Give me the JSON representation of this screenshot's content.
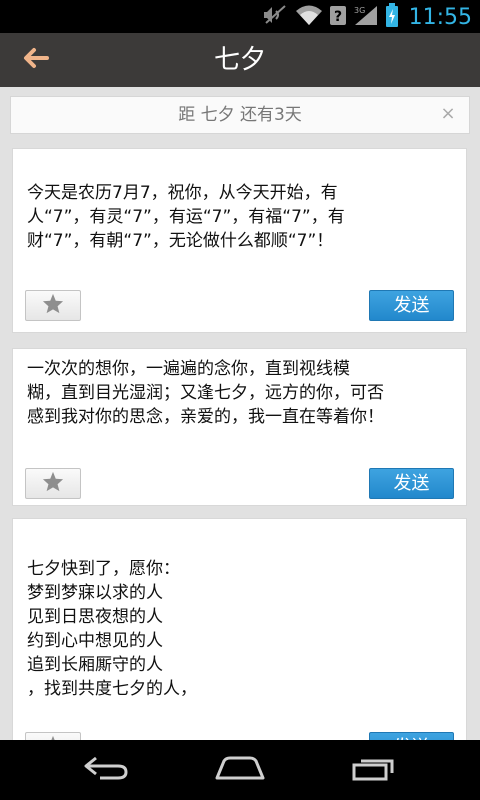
{
  "status_bar": {
    "time": "11:55",
    "icons": [
      "mute-icon",
      "wifi-icon",
      "signal-unknown-icon",
      "3g-signal-icon",
      "battery-charging-icon"
    ],
    "network_label": "3G",
    "accent_color": "#33b5e5"
  },
  "header": {
    "title": "七夕",
    "back_icon": "arrow-left-icon",
    "back_color": "#f0b48a"
  },
  "countdown": {
    "text": "距 七夕 还有3天",
    "close_label": "×"
  },
  "messages": [
    {
      "text": "今天是农历7月7，祝你，从今天开始，有\n人“7”，有灵“7”，有运“7”，有福“7”，有\n财“7”，有朝“7”，无论做什么都顺“7”！",
      "send_label": "发送",
      "favorite_icon": "star-icon"
    },
    {
      "text": "一次次的想你，一遍遍的念你，直到视线模\n糊，直到目光湿润；又逢七夕，远方的你，可否\n感到我对你的思念，亲爱的，我一直在等着你！",
      "send_label": "发送",
      "favorite_icon": "star-icon"
    },
    {
      "text": "七夕快到了，愿你：\n梦到梦寐以求的人\n见到日思夜想的人\n约到心中想见的人\n追到长厢厮守的人\n，找到共度七夕的人，",
      "send_label": "发送",
      "favorite_icon": "star-icon"
    }
  ],
  "nav_bar": {
    "icons": [
      "nav-back-icon",
      "nav-home-icon",
      "nav-recents-icon"
    ]
  },
  "colors": {
    "action_bar": "#3c3a39",
    "send_button": "#2a8fd3",
    "background": "#e1e1e1"
  }
}
